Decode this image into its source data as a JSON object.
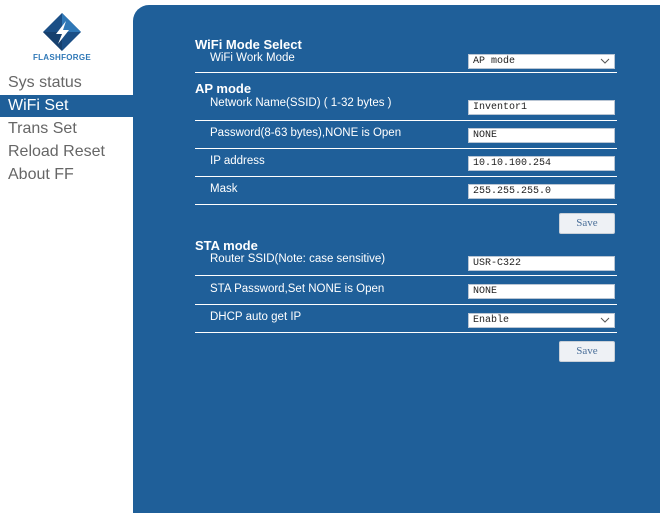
{
  "brand": {
    "name": "FLASHFORGE",
    "logo_color": "#2f78b7"
  },
  "sidebar": {
    "items": [
      {
        "label": "Sys status",
        "active": false
      },
      {
        "label": "WiFi Set",
        "active": true
      },
      {
        "label": "Trans Set",
        "active": false
      },
      {
        "label": "Reload Reset",
        "active": false
      },
      {
        "label": "About FF",
        "active": false
      }
    ]
  },
  "colors": {
    "panel": "#1f5f99",
    "active_nav": "#1f5f99",
    "text_nav": "#666666"
  },
  "wifi_mode": {
    "title": "WiFi Mode Select",
    "label": "WiFi Work Mode",
    "value": "AP mode",
    "icon": "chevron-down-icon"
  },
  "ap_mode": {
    "title": "AP mode",
    "ssid_label": "Network Name(SSID) ( 1-32 bytes )",
    "ssid_value": "Inventor1",
    "password_label": "Password(8-63 bytes),NONE is Open",
    "password_value": "NONE",
    "ip_label": "IP address",
    "ip_value": "10.10.100.254",
    "mask_label": "Mask",
    "mask_value": "255.255.255.0",
    "save_label": "Save"
  },
  "sta_mode": {
    "title": "STA mode",
    "ssid_label": "Router SSID(Note: case sensitive)",
    "ssid_value": "USR-C322",
    "password_label": "STA Password,Set NONE is Open",
    "password_value": "NONE",
    "dhcp_label": "DHCP auto get IP",
    "dhcp_value": "Enable",
    "save_label": "Save"
  }
}
